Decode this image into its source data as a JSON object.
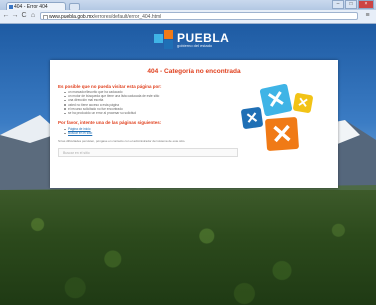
{
  "browser": {
    "tab_title": "404 - Error 404",
    "tab_close": "×",
    "url_host": "www.puebla.gob.mx",
    "url_path": "/errores/default/error_404.html",
    "back": "←",
    "forward": "→",
    "reload": "C",
    "home": "⌂",
    "menu": "≡",
    "minimize": "–",
    "maximize": "□",
    "close": "×"
  },
  "logo": {
    "name": "PUEBLA",
    "tagline": "gobierno del estado"
  },
  "card": {
    "title": "404 - Categoría no encontrada",
    "reasons_heading": "Es posible que no pueda visitar esta página por:",
    "reasons": [
      "un marcador/favorito que ha caducado",
      "un motor de búsqueda que tiene una lista caducada de este sitio",
      "una dirección mal escrita",
      "usted no tiene acceso a esta página",
      "el recurso solicitado no fue encontrado",
      "se ha producido un error al procesar su solicitud"
    ],
    "try_heading": "Por favor, intente una de las páginas siguientes:",
    "links": [
      "Página de inicio",
      "Buscar en el sitio"
    ],
    "search_placeholder": "Buscar en el sitio",
    "footnote": "Si las dificultades persisten, póngase en contacto con el administrador del sistema de este sitio."
  },
  "colors": {
    "accent": "#e0401e",
    "box_blue": "#1f6fb5",
    "box_cyan": "#3fb4e6",
    "box_yellow": "#f2c316",
    "box_orange": "#f07a16"
  }
}
